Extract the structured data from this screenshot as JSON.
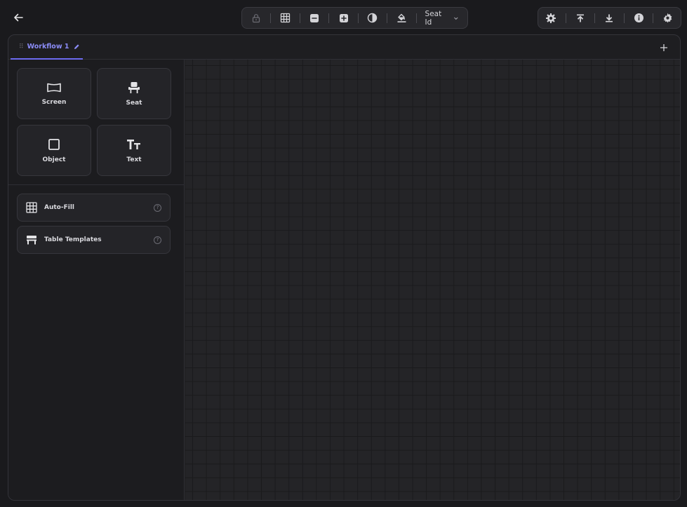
{
  "toolbar": {
    "seat_select_label": "Seat Id"
  },
  "tabs": [
    {
      "label": "Workflow 1",
      "active": true
    }
  ],
  "tools": [
    {
      "label": "Screen",
      "icon": "screen-icon"
    },
    {
      "label": "Seat",
      "icon": "seat-icon"
    },
    {
      "label": "Object",
      "icon": "square-icon"
    },
    {
      "label": "Text",
      "icon": "text-size-icon"
    }
  ],
  "actions": [
    {
      "label": "Auto-Fill",
      "icon": "grid-icon",
      "help": "?"
    },
    {
      "label": "Table Templates",
      "icon": "table-icon",
      "help": "?"
    }
  ],
  "colors": {
    "accent": "#6d6af0",
    "background": "#1a1a1d",
    "canvas": "#242427"
  }
}
